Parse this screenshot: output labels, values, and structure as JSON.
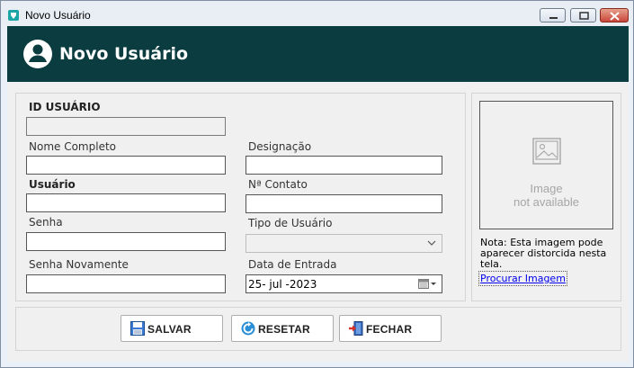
{
  "window": {
    "title": "Novo Usuário"
  },
  "header": {
    "title": "Novo Usuário"
  },
  "form": {
    "id_label": "ID USUÁRIO",
    "id_value": "",
    "nome_label": "Nome Completo",
    "nome_value": "",
    "designacao_label": "Designação",
    "designacao_value": "",
    "usuario_label": "Usuário",
    "usuario_value": "",
    "contato_label": "Nª Contato",
    "contato_value": "",
    "senha_label": "Senha",
    "senha_value": "",
    "tipo_label": "Tipo de Usuário",
    "tipo_value": "",
    "senha2_label": "Senha Novamente",
    "senha2_value": "",
    "data_label": "Data de Entrada",
    "data_value": "25- jul -2023"
  },
  "image_panel": {
    "placeholder_line1": "Image",
    "placeholder_line2": "not available",
    "note": "Nota: Esta imagem pode aparecer distorcida nesta tela.",
    "browse_link": "Procurar Imagem"
  },
  "buttons": {
    "salvar": "SALVAR",
    "resetar": "RESETAR",
    "fechar": "FECHAR"
  },
  "colors": {
    "header_bg": "#0b3c3f",
    "link": "#0000ee"
  },
  "icons": {
    "app": "app-icon",
    "user": "user-circle-icon",
    "image_placeholder": "image-icon",
    "salvar": "save-icon",
    "resetar": "reset-icon",
    "fechar": "exit-door-icon",
    "calendar": "calendar-icon",
    "dropdown": "chevron-down-icon"
  }
}
